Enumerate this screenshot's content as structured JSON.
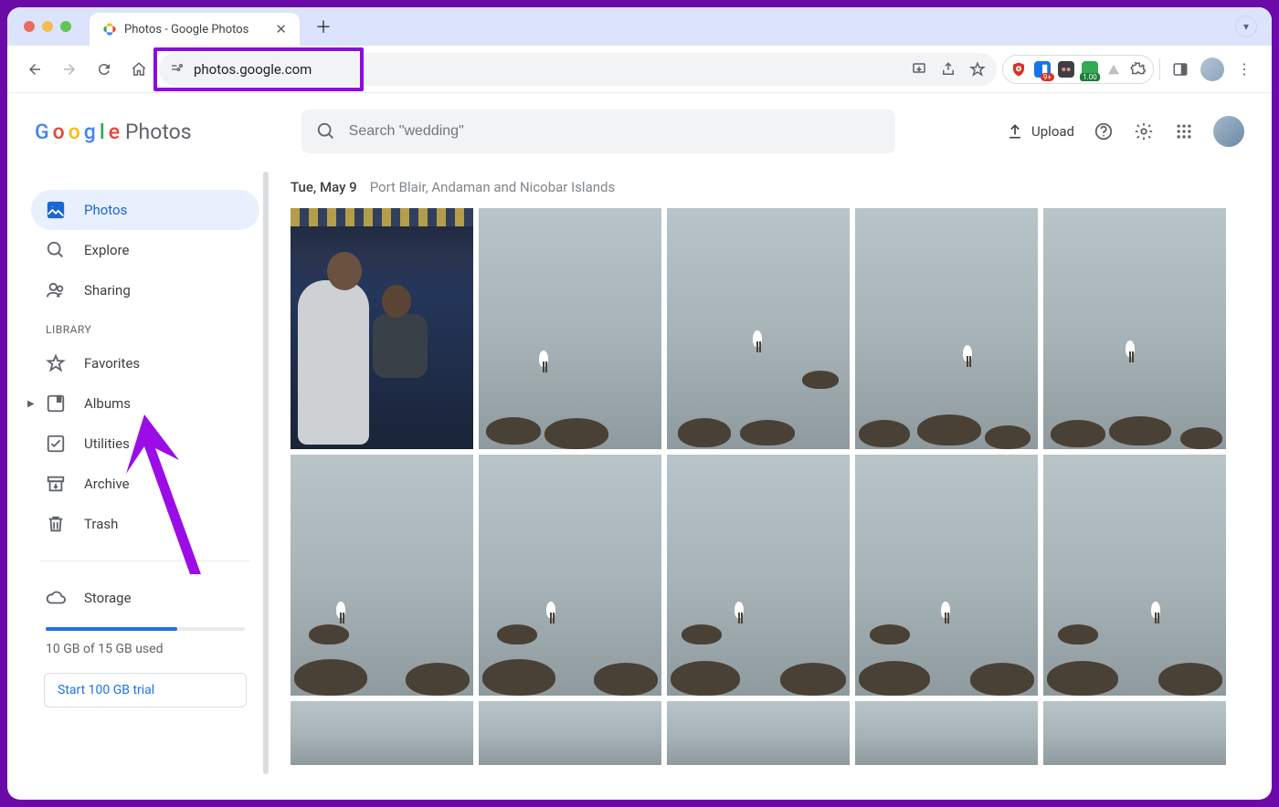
{
  "browser": {
    "tab_title": "Photos - Google Photos",
    "url": "photos.google.com",
    "extension_badge": "9+",
    "extension_badge2": "1.00"
  },
  "header": {
    "logo_text": "Photos",
    "search_placeholder": "Search \"wedding\"",
    "upload_label": "Upload"
  },
  "sidebar": {
    "nav": [
      {
        "label": "Photos",
        "icon": "image-icon",
        "active": true
      },
      {
        "label": "Explore",
        "icon": "search-icon",
        "active": false
      },
      {
        "label": "Sharing",
        "icon": "people-icon",
        "active": false
      }
    ],
    "library_label": "LIBRARY",
    "library": [
      {
        "label": "Favorites",
        "icon": "star-icon"
      },
      {
        "label": "Albums",
        "icon": "album-icon",
        "expandable": true
      },
      {
        "label": "Utilities",
        "icon": "checkbox-icon"
      },
      {
        "label": "Archive",
        "icon": "archive-icon"
      },
      {
        "label": "Trash",
        "icon": "trash-icon"
      }
    ],
    "storage": {
      "label": "Storage",
      "used_text": "10 GB of 15 GB used",
      "fill_percent": 66,
      "trial_button": "Start 100 GB trial"
    }
  },
  "main": {
    "date": "Tue, May 9",
    "location": "Port Blair, Andaman and Nicobar Islands"
  },
  "annotation": {
    "highlight": "url-highlight",
    "arrow_target": "Albums"
  }
}
